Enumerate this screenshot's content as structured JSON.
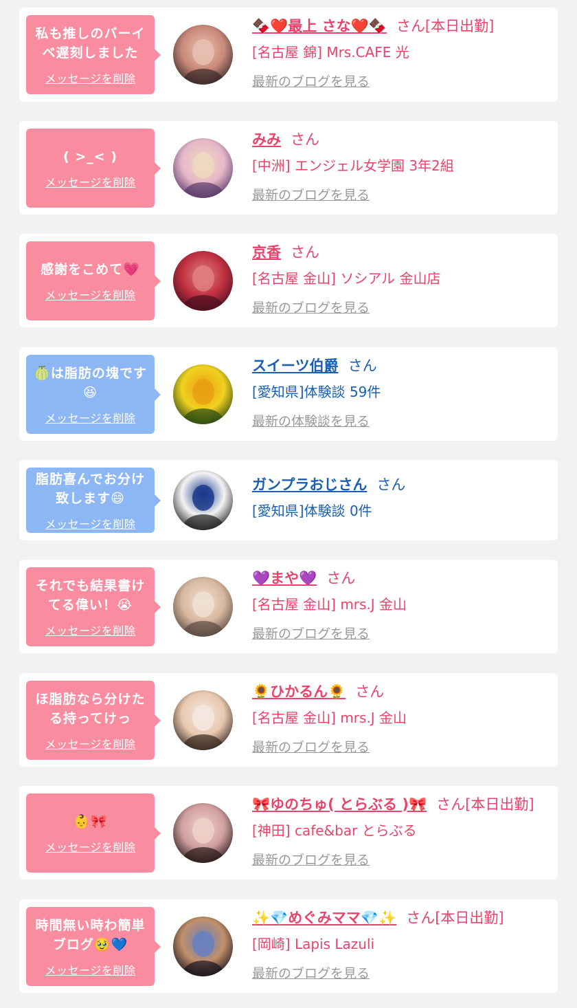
{
  "delete_label": "メッセージを削除",
  "colors": {
    "pink": "#e8436a",
    "blue": "#1a5fb4",
    "bubble_pink": "#fa8c9f",
    "bubble_blue": "#8db6f4",
    "link_gray": "#999999"
  },
  "items": [
    {
      "message": "私も推しのバーイ\nベ遅刻しました",
      "bubble": "pink",
      "name": "🍫❤️最上 さな❤️🍫",
      "suffix": "さん[本日出勤]",
      "shop": "[名古屋 錦] Mrs.CAFE 光",
      "link": "最新のブログを見る",
      "avatar_icon": "avatar-woman-photo"
    },
    {
      "message": "( >_< )",
      "bubble": "pink",
      "name": "みみ",
      "suffix": "さん",
      "shop": "[中洲] エンジェル女学園 3年2組",
      "link": "最新のブログを見る",
      "avatar_icon": "avatar-woman-photo"
    },
    {
      "message": "感謝をこめて💗",
      "bubble": "pink",
      "name": "京香",
      "suffix": "さん",
      "shop": "[名古屋 金山] ソシアル 金山店",
      "link": "最新のブログを見る",
      "avatar_icon": "avatar-woman-photo"
    },
    {
      "message": "🍈は脂肪の塊です\n😆",
      "bubble": "blue",
      "name": "スイーツ伯爵",
      "suffix": "さん",
      "shop": "[愛知県]体験談 59件",
      "link": "最新の体験談を見る",
      "avatar_icon": "avatar-flower-photo"
    },
    {
      "message": "脂肪喜んでお分け\n致します😄",
      "bubble": "blue",
      "name": "ガンプラおじさん",
      "suffix": "さん",
      "shop": "[愛知県]体験談 0件",
      "link": "",
      "avatar_icon": "avatar-robot-photo"
    },
    {
      "message": "それでも結果書け\nてる偉い！😭",
      "bubble": "pink",
      "name": "💜まや💜",
      "suffix": "さん",
      "shop": "[名古屋 金山] mrs.J 金山",
      "link": "最新のブログを見る",
      "avatar_icon": "avatar-woman-photo"
    },
    {
      "message": "ほ脂肪なら分けた\nる持ってけっ",
      "bubble": "pink",
      "name": "🌻ひかるん🌻",
      "suffix": "さん",
      "shop": "[名古屋 金山] mrs.J 金山",
      "link": "最新のブログを見る",
      "avatar_icon": "avatar-woman-photo"
    },
    {
      "message": "👶🎀",
      "bubble": "pink",
      "name": "🎀ゆのちゅ( とらぶる )🎀",
      "suffix": "さん[本日出勤]",
      "shop": "[神田] cafe&bar とらぶる",
      "link": "最新のブログを見る",
      "avatar_icon": "avatar-woman-photo"
    },
    {
      "message": "時間無い時わ簡単\nブログ🥹💙",
      "bubble": "pink",
      "name": "✨💎めぐみママ💎✨",
      "suffix": "さん[本日出勤]",
      "shop": "[岡崎] Lapis Lazuli",
      "link": "最新のブログを見る",
      "avatar_icon": "avatar-woman-photo"
    }
  ]
}
